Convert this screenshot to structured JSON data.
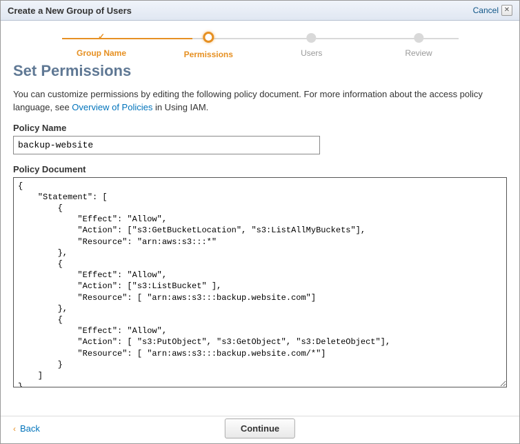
{
  "header": {
    "title": "Create a New Group of Users",
    "cancel": "Cancel"
  },
  "wizard": {
    "steps": [
      {
        "label": "Group Name",
        "state": "done"
      },
      {
        "label": "Permissions",
        "state": "current"
      },
      {
        "label": "Users",
        "state": "pending"
      },
      {
        "label": "Review",
        "state": "pending"
      }
    ]
  },
  "section": {
    "title": "Set Permissions",
    "desc_before": "You can customize permissions by editing the following policy document. For more information about the access policy language, see ",
    "desc_link": "Overview of Policies",
    "desc_after": " in Using IAM."
  },
  "form": {
    "policy_name_label": "Policy Name",
    "policy_name_value": "backup-website",
    "policy_document_label": "Policy Document",
    "policy_document_value": "{\n    \"Statement\": [\n        {\n            \"Effect\": \"Allow\",\n            \"Action\": [\"s3:GetBucketLocation\", \"s3:ListAllMyBuckets\"],\n            \"Resource\": \"arn:aws:s3:::*\"\n        },\n        {\n            \"Effect\": \"Allow\",\n            \"Action\": [\"s3:ListBucket\" ],\n            \"Resource\": [ \"arn:aws:s3:::backup.website.com\"]\n        },\n        {\n            \"Effect\": \"Allow\",\n            \"Action\": [ \"s3:PutObject\", \"s3:GetObject\", \"s3:DeleteObject\"],\n            \"Resource\": [ \"arn:aws:s3:::backup.website.com/*\"]\n        }\n    ]\n}"
  },
  "footer": {
    "back": "Back",
    "continue": "Continue"
  }
}
